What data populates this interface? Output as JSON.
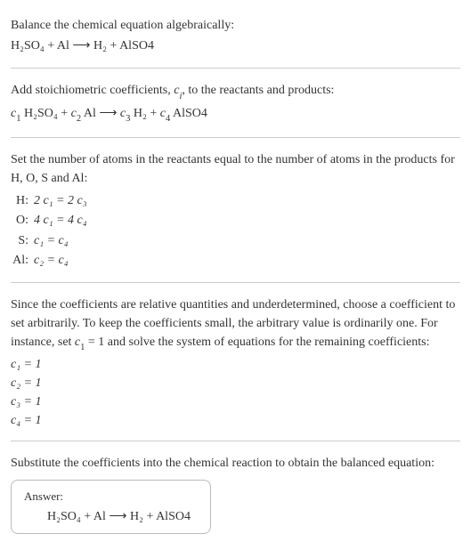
{
  "section1": {
    "title": "Balance the chemical equation algebraically:",
    "equation": "H₂SO₄ + Al ⟶ H₂ + AlSO4"
  },
  "section2": {
    "intro_a": "Add stoichiometric coefficients, ",
    "intro_ci": "c",
    "intro_ci_sub": "i",
    "intro_b": ", to the reactants and products:",
    "equation_parts": {
      "c1": "c",
      "c1s": "1",
      "r1": " H₂SO₄ + ",
      "c2": "c",
      "c2s": "2",
      "r2": " Al ⟶ ",
      "c3": "c",
      "c3s": "3",
      "r3": " H₂ + ",
      "c4": "c",
      "c4s": "4",
      "r4": " AlSO4"
    }
  },
  "section3": {
    "intro": "Set the number of atoms in the reactants equal to the number of atoms in the products for H, O, S and Al:",
    "rows": [
      {
        "label": "H:",
        "eq": "2 c₁ = 2 c₃"
      },
      {
        "label": "O:",
        "eq": "4 c₁ = 4 c₄"
      },
      {
        "label": "S:",
        "eq": "c₁ = c₄"
      },
      {
        "label": "Al:",
        "eq": "c₂ = c₄"
      }
    ]
  },
  "section4": {
    "intro_a": "Since the coefficients are relative quantities and underdetermined, choose a coefficient to set arbitrarily. To keep the coefficients small, the arbitrary value is ordinarily one. For instance, set ",
    "c1": "c",
    "c1s": "1",
    "intro_b": " = 1 and solve the system of equations for the remaining coefficients:",
    "coeffs": [
      "c₁ = 1",
      "c₂ = 1",
      "c₃ = 1",
      "c₄ = 1"
    ]
  },
  "section5": {
    "intro": "Substitute the coefficients into the chemical reaction to obtain the balanced equation:"
  },
  "answer": {
    "label": "Answer:",
    "equation": "H₂SO₄ + Al ⟶ H₂ + AlSO4"
  }
}
